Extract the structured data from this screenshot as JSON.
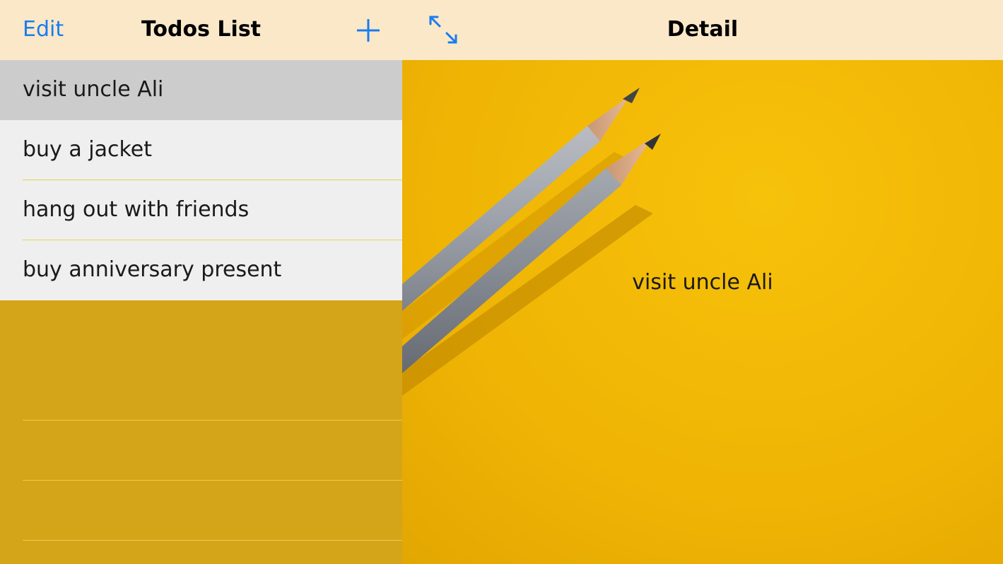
{
  "master": {
    "edit_label": "Edit",
    "title": "Todos List",
    "add_icon": "plus-icon",
    "items": [
      {
        "label": "visit uncle Ali",
        "selected": true
      },
      {
        "label": "buy a jacket",
        "selected": false
      },
      {
        "label": "hang out with friends",
        "selected": false
      },
      {
        "label": "buy anniversary present",
        "selected": false
      }
    ]
  },
  "detail": {
    "expand_icon": "expand-arrows-icon",
    "title": "Detail",
    "text": "visit uncle Ali",
    "background_image": "pencils-on-yellow-paper"
  },
  "colors": {
    "accent": "#1a7cf0",
    "nav_background": "#fae8c8",
    "row_background": "#efefef",
    "row_selected": "#cccccc",
    "master_empty_background": "#d4a419",
    "detail_background": "#f2b705"
  }
}
